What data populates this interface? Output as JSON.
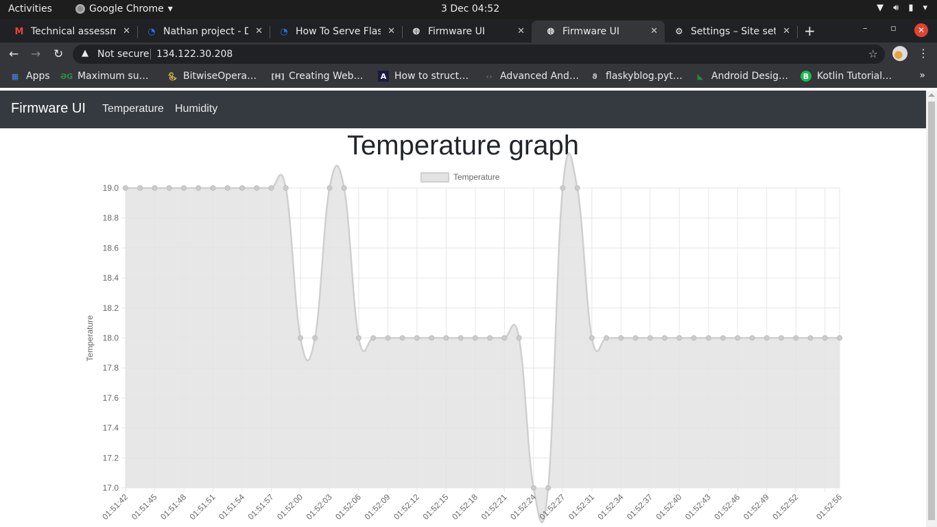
{
  "os": {
    "activities": "Activities",
    "app_name": "Google Chrome",
    "clock": "3 Dec  04:52"
  },
  "browser": {
    "tabs": [
      {
        "label": "Technical assessment",
        "icon": "gmail-icon",
        "active": false
      },
      {
        "label": "Nathan project - Di",
        "icon": "digitalocean-icon",
        "active": false
      },
      {
        "label": "How To Serve Flask",
        "icon": "digitalocean-icon",
        "active": false
      },
      {
        "label": "Firmware UI",
        "icon": "globe-icon",
        "active": false
      },
      {
        "label": "Firmware UI",
        "icon": "globe-icon",
        "active": true
      },
      {
        "label": "Settings – Site sett",
        "icon": "gear-icon",
        "active": false
      }
    ],
    "security_label": "Not secure",
    "url": "134.122.30.208",
    "bookmarks": [
      {
        "label": "Apps",
        "icon": "apps-grid-icon",
        "color": "#4285f4"
      },
      {
        "label": "Maximum su…",
        "icon": "geeksforgeeks-icon",
        "color": "#2f8d46"
      },
      {
        "label": "BitwiseOpera…",
        "icon": "python-icon",
        "color": "#ffd43b"
      },
      {
        "label": "Creating Web…",
        "icon": "producthunt-icon",
        "color": "#cccccc"
      },
      {
        "label": "How to struct…",
        "icon": "angular-icon",
        "color": "#1a1a40"
      },
      {
        "label": "Advanced And…",
        "icon": "code-icon",
        "color": "#5f6b7a"
      },
      {
        "label": "flaskyblog.pyt…",
        "icon": "flask-icon",
        "color": "#cccccc"
      },
      {
        "label": "Android Desig…",
        "icon": "android-design-icon",
        "color": "#1e8e3e"
      },
      {
        "label": "Kotlin Tutorial…",
        "icon": "kotlin-b-icon",
        "color": "#1db954"
      }
    ]
  },
  "app": {
    "brand": "Firmware UI",
    "nav": [
      "Temperature",
      "Humidity"
    ],
    "page_title": "Temperature graph"
  },
  "colors": {
    "navbar": "#343a40",
    "series_fill": "#e3e3e3",
    "series_line": "#cfcfcf",
    "point": "#cccccc",
    "grid": "#e6e6e6"
  },
  "chart_data": {
    "type": "area",
    "title": "",
    "xlabel": "",
    "ylabel": "Temperature",
    "ylim": [
      17.0,
      19.0
    ],
    "yticks": [
      17.0,
      17.2,
      17.4,
      17.6,
      17.8,
      18.0,
      18.2,
      18.4,
      18.6,
      18.8,
      19.0
    ],
    "legend": {
      "position": "top",
      "entries": [
        "Temperature"
      ]
    },
    "grid": true,
    "x_tick_labels": [
      "01:51:42",
      "01:51:45",
      "01:51:48",
      "01:51:51",
      "01:51:54",
      "01:51:57",
      "01:52:00",
      "01:52:03",
      "01:52:06",
      "01:52:09",
      "01:52:12",
      "01:52:15",
      "01:52:18",
      "01:52:21",
      "01:52:24",
      "01:52:27",
      "01:52:31",
      "01:52:34",
      "01:52:37",
      "01:52:40",
      "01:52:43",
      "01:52:46",
      "01:52:49",
      "01:52:52",
      "01:52:56"
    ],
    "x_tick_every_n_points": 2,
    "series": [
      {
        "name": "Temperature",
        "values": [
          19.0,
          19.0,
          19.0,
          19.0,
          19.0,
          19.0,
          19.0,
          19.0,
          19.0,
          19.0,
          19.0,
          19.0,
          18.0,
          18.0,
          19.0,
          19.0,
          18.0,
          18.0,
          18.0,
          18.0,
          18.0,
          18.0,
          18.0,
          18.0,
          18.0,
          18.0,
          18.0,
          18.0,
          17.0,
          17.0,
          19.0,
          19.0,
          18.0,
          18.0,
          18.0,
          18.0,
          18.0,
          18.0,
          18.0,
          18.0,
          18.0,
          18.0,
          18.0,
          18.0,
          18.0,
          18.0,
          18.0,
          18.0,
          18.0,
          18.0
        ]
      }
    ]
  }
}
